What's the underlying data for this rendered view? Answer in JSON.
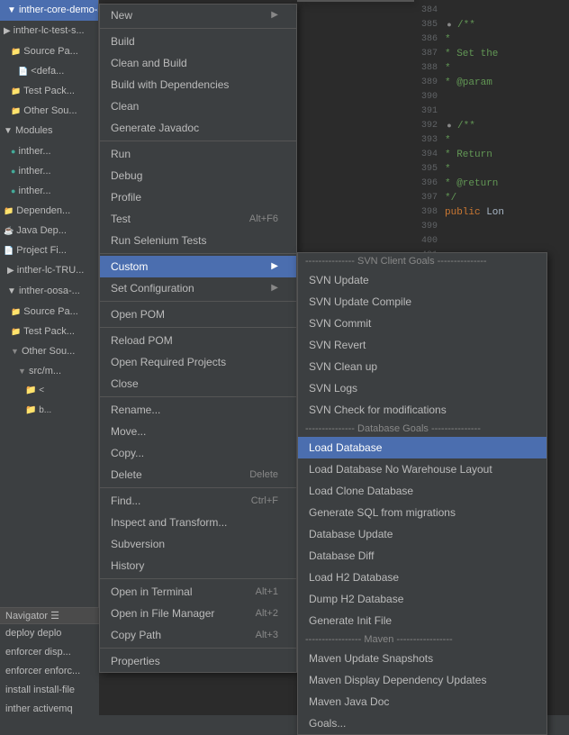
{
  "sidebar": {
    "items": [
      {
        "label": "inther-core-demo-setup",
        "active": true,
        "depth": 0
      },
      {
        "label": "inther-lc-test-s...",
        "active": false,
        "depth": 0
      },
      {
        "label": "Source Pa...",
        "active": false,
        "depth": 1
      },
      {
        "label": "<defa...",
        "active": false,
        "depth": 2
      },
      {
        "label": "Test Pack...",
        "active": false,
        "depth": 1
      },
      {
        "label": "Other Sou...",
        "active": false,
        "depth": 1
      },
      {
        "label": "Modules",
        "active": false,
        "depth": 0
      },
      {
        "label": "inther...",
        "active": false,
        "depth": 1
      },
      {
        "label": "inther...",
        "active": false,
        "depth": 1
      },
      {
        "label": "inther...",
        "active": false,
        "depth": 1
      },
      {
        "label": "Dependen...",
        "active": false,
        "depth": 0
      },
      {
        "label": "Java Dep...",
        "active": false,
        "depth": 0
      },
      {
        "label": "Project Fi...",
        "active": false,
        "depth": 0
      },
      {
        "label": "inther-lc-TRU...",
        "active": false,
        "depth": 0
      },
      {
        "label": "inther-oosa-...",
        "active": false,
        "depth": 0
      },
      {
        "label": "Source Pa...",
        "active": false,
        "depth": 1
      },
      {
        "label": "Test Pack...",
        "active": false,
        "depth": 1
      },
      {
        "label": "Other Sou...",
        "active": false,
        "depth": 1
      },
      {
        "label": "src/m...",
        "active": false,
        "depth": 2
      },
      {
        "label": "<",
        "active": false,
        "depth": 3
      },
      {
        "label": "b...",
        "active": false,
        "depth": 3
      }
    ]
  },
  "context_menu": {
    "items": [
      {
        "label": "New",
        "shortcut": "",
        "arrow": true,
        "separator": false,
        "highlighted": false
      },
      {
        "label": "",
        "shortcut": "",
        "arrow": false,
        "separator": true,
        "highlighted": false
      },
      {
        "label": "Build",
        "shortcut": "",
        "arrow": false,
        "separator": false,
        "highlighted": false
      },
      {
        "label": "Clean and Build",
        "shortcut": "",
        "arrow": false,
        "separator": false,
        "highlighted": false
      },
      {
        "label": "Build with Dependencies",
        "shortcut": "",
        "arrow": false,
        "separator": false,
        "highlighted": false
      },
      {
        "label": "Clean",
        "shortcut": "",
        "arrow": false,
        "separator": false,
        "highlighted": false
      },
      {
        "label": "Generate Javadoc",
        "shortcut": "",
        "arrow": false,
        "separator": false,
        "highlighted": false
      },
      {
        "label": "",
        "shortcut": "",
        "arrow": false,
        "separator": true,
        "highlighted": false
      },
      {
        "label": "Run",
        "shortcut": "",
        "arrow": false,
        "separator": false,
        "highlighted": false
      },
      {
        "label": "Debug",
        "shortcut": "",
        "arrow": false,
        "separator": false,
        "highlighted": false
      },
      {
        "label": "Profile",
        "shortcut": "",
        "arrow": false,
        "separator": false,
        "highlighted": false
      },
      {
        "label": "Test",
        "shortcut": "Alt+F6",
        "arrow": false,
        "separator": false,
        "highlighted": false
      },
      {
        "label": "Run Selenium Tests",
        "shortcut": "",
        "arrow": false,
        "separator": false,
        "highlighted": false
      },
      {
        "label": "",
        "shortcut": "",
        "arrow": false,
        "separator": true,
        "highlighted": false
      },
      {
        "label": "Custom",
        "shortcut": "",
        "arrow": true,
        "separator": false,
        "highlighted": true
      },
      {
        "label": "Set Configuration",
        "shortcut": "",
        "arrow": true,
        "separator": false,
        "highlighted": false
      },
      {
        "label": "",
        "shortcut": "",
        "arrow": false,
        "separator": true,
        "highlighted": false
      },
      {
        "label": "Open POM",
        "shortcut": "",
        "arrow": false,
        "separator": false,
        "highlighted": false
      },
      {
        "label": "",
        "shortcut": "",
        "arrow": false,
        "separator": true,
        "highlighted": false
      },
      {
        "label": "Reload POM",
        "shortcut": "",
        "arrow": false,
        "separator": false,
        "highlighted": false
      },
      {
        "label": "Open Required Projects",
        "shortcut": "",
        "arrow": false,
        "separator": false,
        "highlighted": false
      },
      {
        "label": "Close",
        "shortcut": "",
        "arrow": false,
        "separator": false,
        "highlighted": false
      },
      {
        "label": "",
        "shortcut": "",
        "arrow": false,
        "separator": true,
        "highlighted": false
      },
      {
        "label": "Rename...",
        "shortcut": "",
        "arrow": false,
        "separator": false,
        "highlighted": false
      },
      {
        "label": "Move...",
        "shortcut": "",
        "arrow": false,
        "separator": false,
        "highlighted": false
      },
      {
        "label": "Copy...",
        "shortcut": "",
        "arrow": false,
        "separator": false,
        "highlighted": false
      },
      {
        "label": "Delete",
        "shortcut": "Delete",
        "arrow": false,
        "separator": false,
        "highlighted": false
      },
      {
        "label": "",
        "shortcut": "",
        "arrow": false,
        "separator": true,
        "highlighted": false
      },
      {
        "label": "Find...",
        "shortcut": "Ctrl+F",
        "arrow": false,
        "separator": false,
        "highlighted": false
      },
      {
        "label": "Inspect and Transform...",
        "shortcut": "",
        "arrow": false,
        "separator": false,
        "highlighted": false
      },
      {
        "label": "Subversion",
        "shortcut": "",
        "arrow": false,
        "separator": false,
        "highlighted": false
      },
      {
        "label": "History",
        "shortcut": "",
        "arrow": false,
        "separator": false,
        "highlighted": false
      },
      {
        "label": "",
        "shortcut": "",
        "arrow": false,
        "separator": true,
        "highlighted": false
      },
      {
        "label": "Open in Terminal",
        "shortcut": "Alt+1",
        "arrow": false,
        "separator": false,
        "highlighted": false
      },
      {
        "label": "Open in File Manager",
        "shortcut": "Alt+2",
        "arrow": false,
        "separator": false,
        "highlighted": false
      },
      {
        "label": "Copy Path",
        "shortcut": "Alt+3",
        "arrow": false,
        "separator": false,
        "highlighted": false
      },
      {
        "label": "",
        "shortcut": "",
        "arrow": false,
        "separator": true,
        "highlighted": false
      },
      {
        "label": "Properties",
        "shortcut": "",
        "arrow": false,
        "separator": false,
        "highlighted": false
      }
    ]
  },
  "submenu_new": {
    "label": "New",
    "items": []
  },
  "submenu_custom": {
    "label": "Custom",
    "sections": [
      {
        "title": "----------------- SVN Client Goals -----------------",
        "items": [
          {
            "label": "SVN Update",
            "highlighted": false
          },
          {
            "label": "SVN Update Compile",
            "highlighted": false
          },
          {
            "label": "SVN Commit",
            "highlighted": false
          },
          {
            "label": "SVN Revert",
            "highlighted": false
          },
          {
            "label": "SVN Clean up",
            "highlighted": false
          },
          {
            "label": "SVN Logs",
            "highlighted": false
          },
          {
            "label": "SVN Check for modifications",
            "highlighted": false
          }
        ]
      },
      {
        "title": "----------------- Database Goals -----------------",
        "items": [
          {
            "label": "Load Database",
            "highlighted": true
          },
          {
            "label": "Load Database No Warehouse Layout",
            "highlighted": false
          },
          {
            "label": "Load Clone Database",
            "highlighted": false
          },
          {
            "label": "Generate SQL from migrations",
            "highlighted": false
          },
          {
            "label": "Database Update",
            "highlighted": false
          },
          {
            "label": "Database Diff",
            "highlighted": false
          },
          {
            "label": "Load H2 Database",
            "highlighted": false
          },
          {
            "label": "Dump H2 Database",
            "highlighted": false
          },
          {
            "label": "Generate Init File",
            "highlighted": false
          }
        ]
      },
      {
        "title": "----------------- Maven -----------------",
        "items": [
          {
            "label": "Maven Update Snapshots",
            "highlighted": false
          },
          {
            "label": "Maven Display Dependency Updates",
            "highlighted": false
          },
          {
            "label": "Maven Java Doc",
            "highlighted": false
          },
          {
            "label": "Goals...",
            "highlighted": false
          }
        ]
      }
    ]
  },
  "code": {
    "lines": [
      {
        "num": "384",
        "content": ""
      },
      {
        "num": "385",
        "content": "/**",
        "gutter": true
      },
      {
        "num": "386",
        "content": " *"
      },
      {
        "num": "387",
        "content": " * Set the"
      },
      {
        "num": "388",
        "content": " *"
      },
      {
        "num": "389",
        "content": " * @param"
      },
      {
        "num": "390",
        "content": ""
      },
      {
        "num": "391",
        "content": ""
      },
      {
        "num": "392",
        "content": "/**",
        "gutter": true
      },
      {
        "num": "393",
        "content": " *"
      },
      {
        "num": "394",
        "content": " * Return"
      },
      {
        "num": "395",
        "content": " *"
      },
      {
        "num": "396",
        "content": " * @return"
      },
      {
        "num": "397",
        "content": " */"
      },
      {
        "num": "398",
        "content": "public Lon"
      }
    ]
  },
  "navigator": {
    "title": "Navigator ☰",
    "items": [
      "deploy deplo",
      "enforcer disp...",
      "enforcer enforc...",
      "install install-file",
      "inther activemq"
    ]
  }
}
